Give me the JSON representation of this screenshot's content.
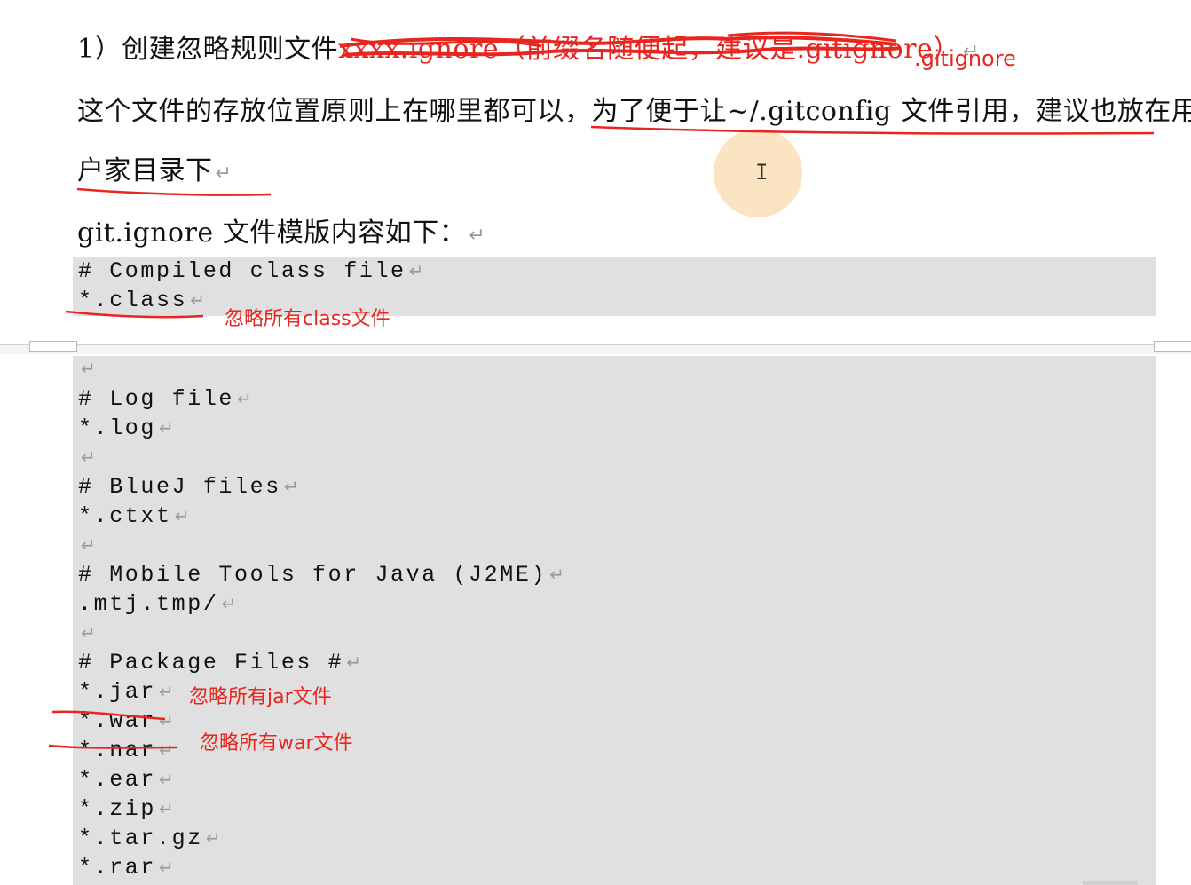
{
  "para1": {
    "text": "1）创建忽略规则文件",
    "crossed_text": "xxxx.ignore（前缀名随便起，建议是.gitignore）"
  },
  "para2": {
    "line1_prefix": "这个文件的存放位置原则上在哪里都可以，",
    "line1_underlined": "为了便于让~/.gitconfig 文件引用，建议也放在用",
    "line2": "户家目录下"
  },
  "para3": {
    "text": "git.ignore 文件模版内容如下："
  },
  "paragraph_mark": "↵",
  "code_top": [
    "# Compiled class file",
    "*.class"
  ],
  "code_bottom": [
    "",
    "# Log file",
    "*.log",
    "",
    "# BlueJ files",
    "*.ctxt",
    "",
    "# Mobile Tools for Java (J2ME)",
    ".mtj.tmp/",
    "",
    "# Package Files #",
    "*.jar",
    "*.war",
    "*.nar",
    "*.ear",
    "*.zip",
    "*.tar.gz",
    "*.rar"
  ],
  "annotations": {
    "gitignore": ".gitignore",
    "ignore_class": "忽略所有class文件",
    "ignore_jar": "忽略所有jar文件",
    "ignore_war": "忽略所有war文件"
  },
  "cursor_icon": "i-beam-cursor",
  "colors": {
    "annotation_red": "#e8261f",
    "code_bg": "#e0e0e0",
    "cursor_halo": "#fbe3bf"
  }
}
